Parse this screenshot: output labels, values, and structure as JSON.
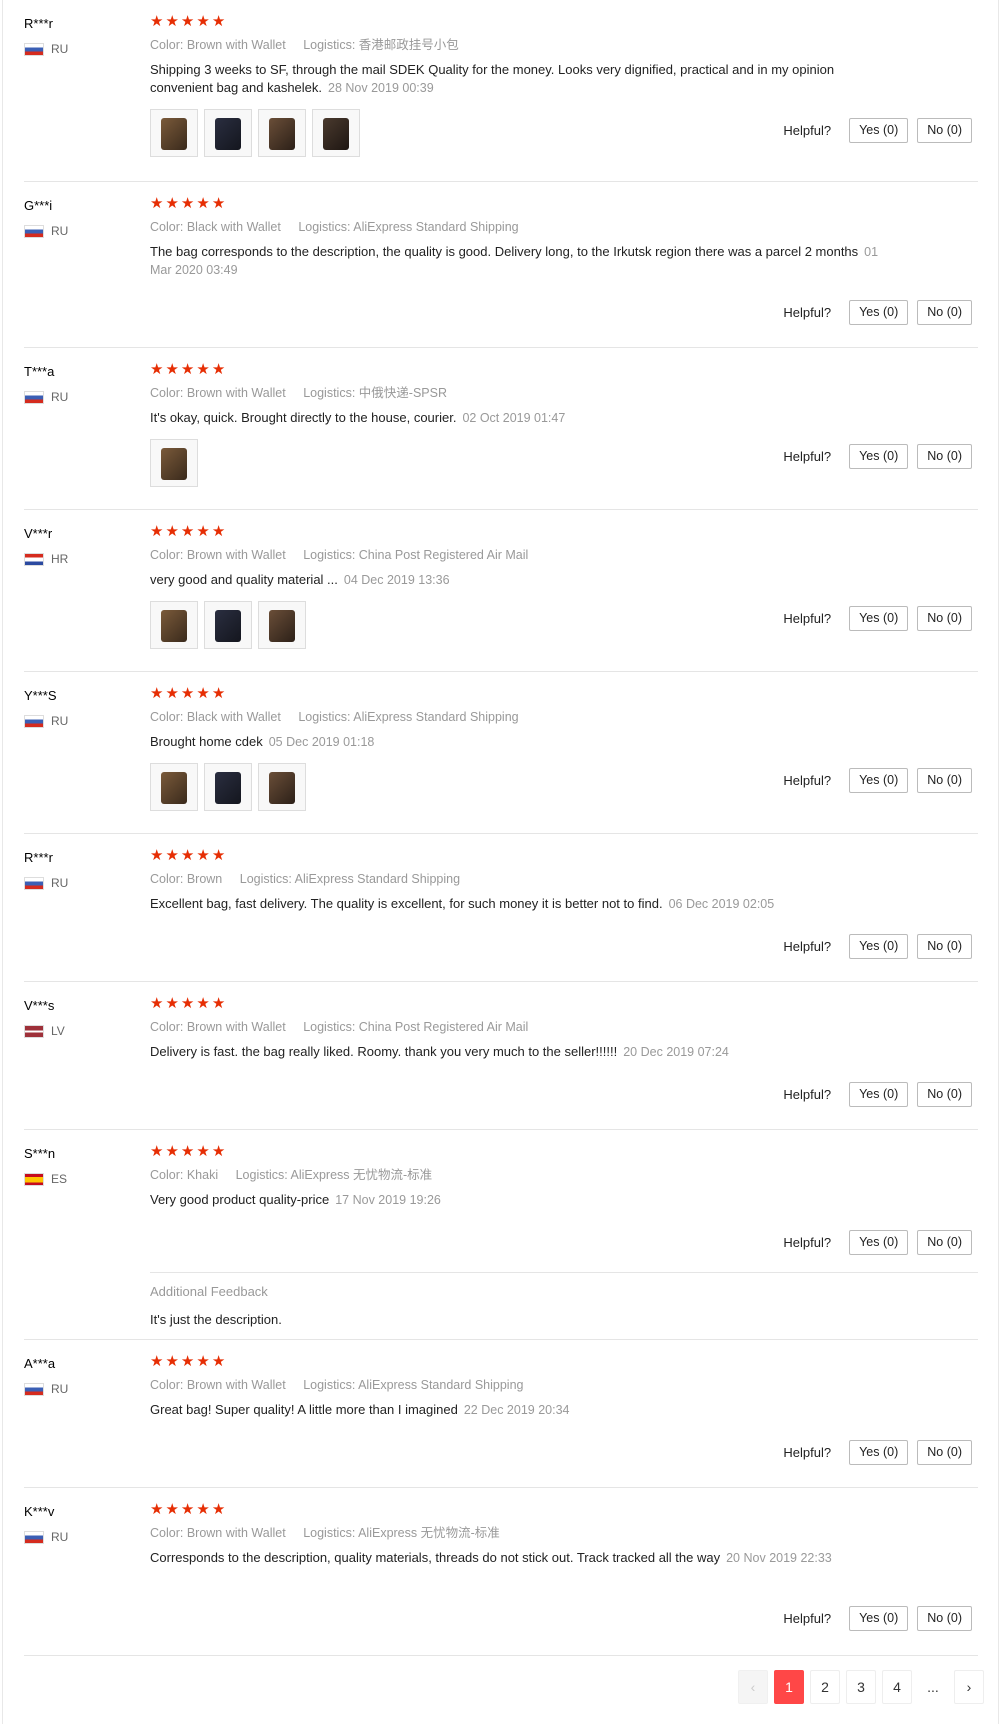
{
  "helpful_label": "Helpful?",
  "color_key": "Color:",
  "logistics_key": "Logistics:",
  "star_color": "#e62e04",
  "reviews": [
    {
      "user": "R***r",
      "country": "RU",
      "rating": 5,
      "color": "Brown with Wallet",
      "logistics": "香港邮政挂号小包",
      "text": "Shipping 3 weeks to SF, through the mail SDEK Quality for the money. Looks very dignified, practical and in my opinion convenient bag and kashelek.",
      "date": "28 Nov 2019 00:39",
      "yes": "Yes (0)",
      "no": "No (0)",
      "photos": 4
    },
    {
      "user": "G***i",
      "country": "RU",
      "rating": 5,
      "color": "Black with Wallet",
      "logistics": "AliExpress Standard Shipping",
      "text": "The bag corresponds to the description, the quality is good. Delivery long, to the Irkutsk region there was a parcel 2 months",
      "date": "01 Mar 2020 03:49",
      "yes": "Yes (0)",
      "no": "No (0)",
      "photos": 0
    },
    {
      "user": "T***a",
      "country": "RU",
      "rating": 5,
      "color": "Brown with Wallet",
      "logistics": "中俄快递-SPSR",
      "text": "It's okay, quick. Brought directly to the house, courier.",
      "date": "02 Oct 2019 01:47",
      "yes": "Yes (0)",
      "no": "No (0)",
      "photos": 1
    },
    {
      "user": "V***r",
      "country": "HR",
      "rating": 5,
      "color": "Brown with Wallet",
      "logistics": "China Post Registered Air Mail",
      "text": "very good and quality material ...",
      "date": "04 Dec 2019 13:36",
      "yes": "Yes (0)",
      "no": "No (0)",
      "photos": 3
    },
    {
      "user": "Y***S",
      "country": "RU",
      "rating": 5,
      "color": "Black with Wallet",
      "logistics": "AliExpress Standard Shipping",
      "text": "Brought home cdek",
      "date": "05 Dec 2019 01:18",
      "yes": "Yes (0)",
      "no": "No (0)",
      "photos": 3
    },
    {
      "user": "R***r",
      "country": "RU",
      "rating": 5,
      "color": "Brown",
      "logistics": "AliExpress Standard Shipping",
      "text": "Excellent bag, fast delivery. The quality is excellent, for such money it is better not to find.",
      "date": "06 Dec 2019 02:05",
      "yes": "Yes (0)",
      "no": "No (0)",
      "photos": 0
    },
    {
      "user": "V***s",
      "country": "LV",
      "rating": 5,
      "color": "Brown with Wallet",
      "logistics": "China Post Registered Air Mail",
      "text": "Delivery is fast. the bag really liked. Roomy. thank you very much to the seller!!!!!!",
      "date": "20 Dec 2019 07:24",
      "yes": "Yes (0)",
      "no": "No (0)",
      "photos": 0
    },
    {
      "user": "S***n",
      "country": "ES",
      "rating": 5,
      "color": "Khaki",
      "logistics": "AliExpress 无忧物流-标准",
      "text": "Very good product quality-price",
      "date": "17 Nov 2019 19:26",
      "yes": "Yes (0)",
      "no": "No (0)",
      "photos": 0,
      "additional_feedback_title": "Additional Feedback",
      "additional_feedback": "It's just the description."
    },
    {
      "user": "A***a",
      "country": "RU",
      "rating": 5,
      "color": "Brown with Wallet",
      "logistics": "AliExpress Standard Shipping",
      "text": "Great bag! Super quality! A little more than I imagined",
      "date": "22 Dec 2019 20:34",
      "yes": "Yes (0)",
      "no": "No (0)",
      "photos": 0
    },
    {
      "user": "K***v",
      "country": "RU",
      "rating": 5,
      "color": "Brown with Wallet",
      "logistics": "AliExpress 无忧物流-标准",
      "text": "Corresponds to the description, quality materials, threads do not stick out. Track tracked all the way",
      "date": "20 Nov 2019 22:33",
      "yes": "Yes (0)",
      "no": "No (0)",
      "photos": 0
    }
  ],
  "pagination": {
    "prev": "‹",
    "pages": [
      "1",
      "2",
      "3",
      "4"
    ],
    "current": "1",
    "ellipsis": "...",
    "next": "›"
  }
}
